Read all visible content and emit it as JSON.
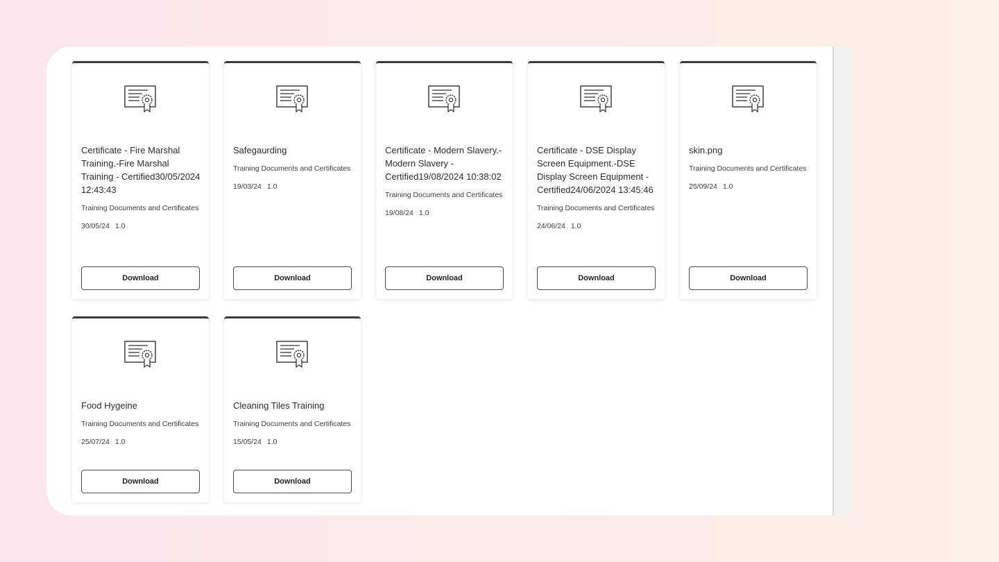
{
  "documents": [
    {
      "title": "Certificate - Fire Marshal Training.-Fire Marshal Training - Certified30/05/2024 12:43:43",
      "category": "Training Documents and Certificates",
      "date": "30/05/24",
      "version": "1.0",
      "button": "Download",
      "icon": "certificate-icon"
    },
    {
      "title": "Safegaurding",
      "category": "Training Documents and Certificates",
      "date": "19/03/24",
      "version": "1.0",
      "button": "Download",
      "icon": "certificate-icon"
    },
    {
      "title": "Certificate - Modern Slavery.-Modern Slavery - Certified19/08/2024 10:38:02",
      "category": "Training Documents and Certificates",
      "date": "19/08/24",
      "version": "1.0",
      "button": "Download",
      "icon": "certificate-icon"
    },
    {
      "title": "Certificate - DSE Display Screen Equipment.-DSE Display Screen Equipment - Certified24/06/2024 13:45:46",
      "category": "Training Documents and Certificates",
      "date": "24/06/24",
      "version": "1.0",
      "button": "Download",
      "icon": "certificate-icon"
    },
    {
      "title": "skin.png",
      "category": "Training Documents and Certificates",
      "date": "25/09/24",
      "version": "1.0",
      "button": "Download",
      "icon": "certificate-icon"
    },
    {
      "title": "Food Hygeine",
      "category": "Training Documents and Certificates",
      "date": "25/07/24",
      "version": "1.0",
      "button": "Download",
      "icon": "certificate-icon"
    },
    {
      "title": "Cleaning Tiles Training",
      "category": "Training Documents and Certificates",
      "date": "15/05/24",
      "version": "1.0",
      "button": "Download",
      "icon": "certificate-icon"
    }
  ],
  "colors": {
    "card_top_border": "#3a3a3a",
    "button_border": "#4a4a4a",
    "text": "#2d2d2d"
  }
}
